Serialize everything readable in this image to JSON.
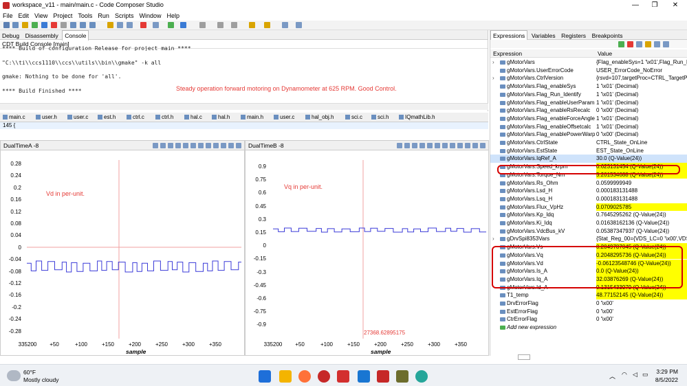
{
  "window": {
    "title": "workspace_v11 - main/main.c - Code Composer Studio"
  },
  "menu": [
    "File",
    "Edit",
    "View",
    "Project",
    "Tools",
    "Run",
    "Scripts",
    "Window",
    "Help"
  ],
  "left_views": {
    "tabs": [
      "Debug",
      "Disassembly",
      "Console"
    ],
    "console_title": "CDT Build Console [main]"
  },
  "console": {
    "lines": [
      "**** Build of configuration Release for project main ****",
      "\"C:\\\\ti\\\\ccs1110\\\\ccs\\\\utils\\\\bin\\\\gmake\" -k all",
      "gmake: Nothing to be done for 'all'.",
      "**** Build Finished ****"
    ],
    "status_note": "Steady operation forward motoring on Dynamometer at 625 RPM. Good Control."
  },
  "editor": {
    "tabs": [
      "main.c",
      "user.h",
      "user.c",
      "est.h",
      "ctrl.c",
      "ctrl.h",
      "hal.c",
      "hal.h",
      "main.h",
      "user.c",
      "hal_obj.h",
      "sci.c",
      "sci.h",
      "IQmathLib.h"
    ],
    "line": "145 {"
  },
  "graph_a": {
    "title": "DualTimeA -8",
    "annotation": "Vd in per-unit.",
    "xlabel": "sample",
    "yticks": [
      "0.28",
      "0.24",
      "0.2",
      "0.16",
      "0.12",
      "0.08",
      "0.04",
      "0",
      "-0.04",
      "-0.08",
      "-0.12",
      "-0.16",
      "-0.2",
      "-0.24",
      "-0.28"
    ],
    "xticks": [
      "335200",
      "+50",
      "+100",
      "+150",
      "+200",
      "+250",
      "+300",
      "+350"
    ]
  },
  "graph_b": {
    "title": "DualTimeB -8",
    "annotation": "Vq in per-unit.",
    "xlabel": "sample",
    "cursor_label": "27368.62895175",
    "yticks": [
      "0.9",
      "0.75",
      "0.6",
      "0.45",
      "0.3",
      "0.15",
      "0",
      "-0.15",
      "-0.3",
      "-0.45",
      "-0.6",
      "-0.75",
      "-0.9"
    ],
    "xticks": [
      "335200",
      "+50",
      "+100",
      "+150",
      "+200",
      "+250",
      "+300",
      "+350"
    ]
  },
  "expressions": {
    "tabs": [
      "Expressions",
      "Variables",
      "Registers",
      "Breakpoints"
    ],
    "header": {
      "name": "Expression",
      "value": "Value"
    },
    "rows": [
      {
        "name": "gMotorVars",
        "value": "{Flag_enableSys=1 '\\x01',Flag_Run_Ide",
        "expand": true
      },
      {
        "name": "gMotorVars.UserErrorCode",
        "value": "USER_ErrorCode_NoError"
      },
      {
        "name": "gMotorVars.CtrlVersion",
        "value": "{rsvd=107,targetProc=CTRL_TargetProc",
        "expand": true
      },
      {
        "name": "gMotorVars.Flag_enableSys",
        "value": "1 '\\x01' (Decimal)"
      },
      {
        "name": "gMotorVars.Flag_Run_Identify",
        "value": "1 '\\x01' (Decimal)"
      },
      {
        "name": "gMotorVars.Flag_enableUserParams",
        "value": "1 '\\x01' (Decimal)"
      },
      {
        "name": "gMotorVars.Flag_enableRsRecalc",
        "value": "0 '\\x00' (Decimal)"
      },
      {
        "name": "gMotorVars.Flag_enableForceAngle",
        "value": "1 '\\x01' (Decimal)"
      },
      {
        "name": "gMotorVars.Flag_enableOffsetcalc",
        "value": "1 '\\x01' (Decimal)"
      },
      {
        "name": "gMotorVars.Flag_enablePowerWarp",
        "value": "0 '\\x00' (Decimal)"
      },
      {
        "name": "gMotorVars.CtrlState",
        "value": "CTRL_State_OnLine"
      },
      {
        "name": "gMotorVars.EstState",
        "value": "EST_State_OnLine"
      },
      {
        "name": "gMotorVars.IqRef_A",
        "value": "30.0 (Q-Value(24))",
        "sel": true
      },
      {
        "name": "gMotorVars.Speed_krpm",
        "value": "0.623131454 (Q-Value(24))",
        "hl": true
      },
      {
        "name": "gMotorVars.Torque_Nm",
        "value": "5.201534688 (Q-Value(24))",
        "hl": true
      },
      {
        "name": "gMotorVars.Rs_Ohm",
        "value": "0.0599999949"
      },
      {
        "name": "gMotorVars.Lsd_H",
        "value": "0.000183131488"
      },
      {
        "name": "gMotorVars.Lsq_H",
        "value": "0.000183131488"
      },
      {
        "name": "gMotorVars.Flux_VpHz",
        "value": "0.0709025785",
        "hl": true
      },
      {
        "name": "gMotorVars.Kp_Idq",
        "value": "0.7645295262 (Q-Value(24))"
      },
      {
        "name": "gMotorVars.Ki_Idq",
        "value": "0.01638162136 (Q-Value(24))"
      },
      {
        "name": "gMotorVars.VdcBus_kV",
        "value": "0.05387347937 (Q-Value(24))"
      },
      {
        "name": "gDrvSpi8353Vars",
        "value": "{Stat_Reg_00={VDS_LC=0 '\\x00',VDS_H",
        "expand": true
      },
      {
        "name": "gMotorVars.Vs",
        "value": "0.2049787045 (Q-Value(24))",
        "hl": true
      },
      {
        "name": "gMotorVars.Vq",
        "value": "0.2048295736 (Q-Value(24))",
        "hl": true
      },
      {
        "name": "gMotorVars.Vd",
        "value": "-0.06123548746 (Q-Value(24))",
        "hl": true
      },
      {
        "name": "gMotorVars.Is_A",
        "value": "0.0 (Q-Value(24))",
        "hl": true
      },
      {
        "name": "gMotorVars.Iq_A",
        "value": "32.03876269 (Q-Value(24))",
        "hl": true
      },
      {
        "name": "gMotorVars.Id_A",
        "value": "0.1315433979 (Q-Value(24))",
        "hl": true
      },
      {
        "name": "T1_temp",
        "value": "48.77152145 (Q-Value(24))",
        "hl": true
      },
      {
        "name": "DrvErrorFlag",
        "value": "0 '\\x00'"
      },
      {
        "name": "EstErrorFlag",
        "value": "0 '\\x00'"
      },
      {
        "name": "CtrErrorFlag",
        "value": "0 '\\x00'"
      },
      {
        "name": "Add new expression",
        "value": "",
        "add": true
      }
    ]
  },
  "taskbar": {
    "weather_temp": "60°F",
    "weather_desc": "Mostly cloudy",
    "time": "3:29 PM",
    "date": "8/5/2022"
  },
  "colors": {
    "accent": "#0b63c5",
    "highlight": "#ffff00",
    "annotation": "#e53935",
    "trace": "#3a3ad8"
  }
}
